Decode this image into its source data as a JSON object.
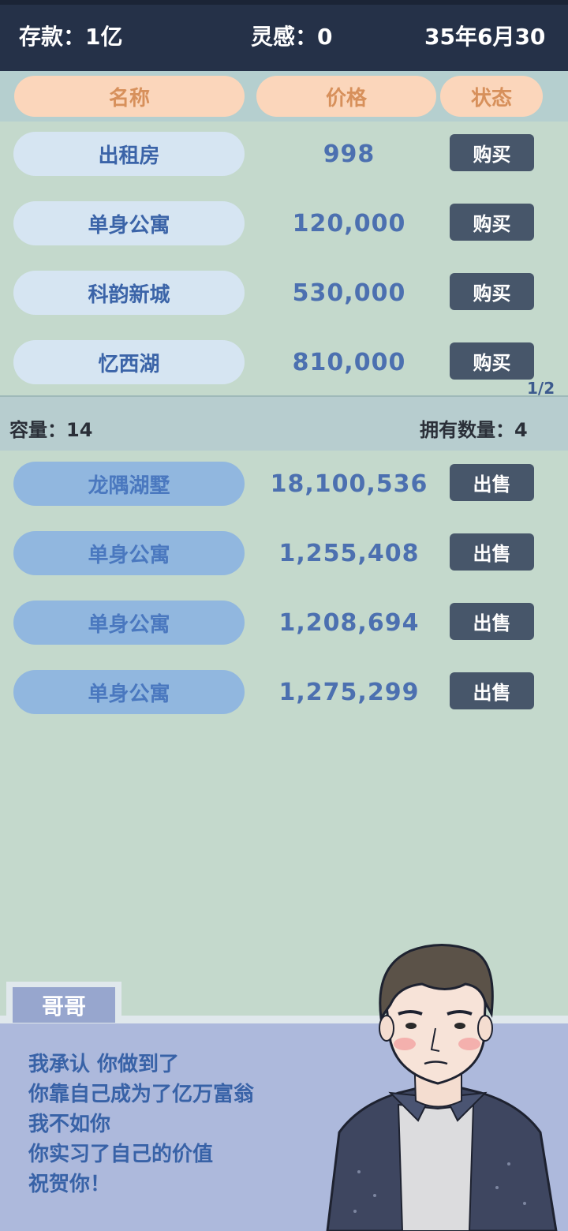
{
  "status": {
    "savings": "存款：1亿",
    "inspiration": "灵感：0",
    "date": "35年6月30"
  },
  "headers": {
    "name": "名称",
    "price": "价格",
    "status": "状态"
  },
  "market": [
    {
      "name": "出租房",
      "price": "998",
      "action": "购买"
    },
    {
      "name": "单身公寓",
      "price": "120,000",
      "action": "购买"
    },
    {
      "name": "科韵新城",
      "price": "530,000",
      "action": "购买"
    },
    {
      "name": "忆西湖",
      "price": "810,000",
      "action": "购买"
    }
  ],
  "page_indicator": "1/2",
  "inventory": {
    "capacity": "容量：14",
    "owned_count": "拥有数量：4"
  },
  "owned": [
    {
      "name": "龙隅湖墅",
      "price": "18,100,536",
      "action": "出售"
    },
    {
      "name": "单身公寓",
      "price": "1,255,408",
      "action": "出售"
    },
    {
      "name": "单身公寓",
      "price": "1,208,694",
      "action": "出售"
    },
    {
      "name": "单身公寓",
      "price": "1,275,299",
      "action": "出售"
    }
  ],
  "dialog": {
    "speaker": "哥哥",
    "lines": [
      "我承认 你做到了",
      "你靠自己成为了亿万富翁",
      "我不如你",
      "你实习了自己的价值",
      "祝贺你！"
    ]
  },
  "colors": {
    "background": "#c4d9cc",
    "topbar": "#253148",
    "header_pill": "#fbd6bb",
    "button": "#47566a",
    "dialog": "#adb9dc"
  }
}
